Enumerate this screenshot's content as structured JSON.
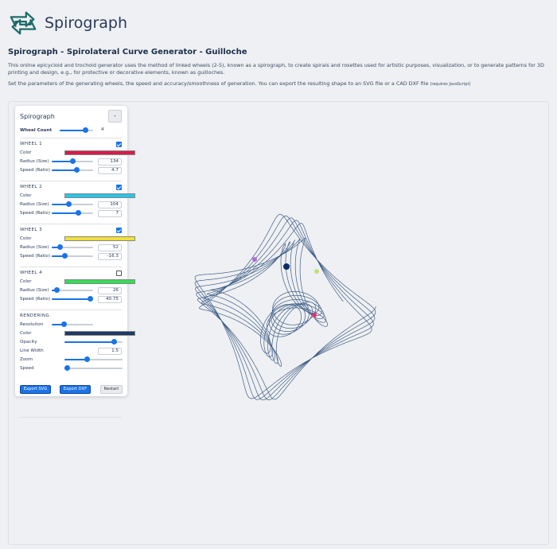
{
  "brand": {
    "name": "Spirograph",
    "logo_icon": "arrows-exchange-icon"
  },
  "page": {
    "title": "Spirograph - Spirolateral Curve Generator - Guilloche",
    "intro": "This online epicycloid and trochoid generator uses the method of linked wheels (2-5), known as a spirograph, to create spirals and rosettes used for artistic purposes, visualization, or to generate patterns for 3D printing and design, e.g., for protective or decorative elements, known as guilloches.",
    "instructions": "Set the parameters of the generating wheels, the speed and accuracy/smoothness of generation. You can export the resulting shape to an SVG file or a CAD DXF file",
    "requires": "(requires JavaScript)"
  },
  "panel": {
    "title": "Spirograph",
    "collapse_label": "-",
    "wheel_count": {
      "label": "Wheel Count",
      "value": "4",
      "level": 0.75
    },
    "wheels": [
      {
        "heading": "WHEEL 1",
        "enabled": true,
        "color_label": "Color",
        "color": "#d81b4a",
        "radius_label": "Radius (Size)",
        "radius": "134",
        "radius_level": 0.5,
        "speed_label": "Speed (Ratio)",
        "speed": "4.7",
        "speed_level": 0.6
      },
      {
        "heading": "WHEEL 2",
        "enabled": true,
        "color_label": "Color",
        "color": "#29c4e8",
        "radius_label": "Radius (Size)",
        "radius": "104",
        "radius_level": 0.4,
        "speed_label": "Speed (Ratio)",
        "speed": "7",
        "speed_level": 0.63
      },
      {
        "heading": "WHEEL 3",
        "enabled": true,
        "color_label": "Color",
        "color": "#f2e034",
        "radius_label": "Radius (Size)",
        "radius": "52",
        "radius_level": 0.2,
        "speed_label": "Speed (Ratio)",
        "speed": "-16.3",
        "speed_level": 0.3
      },
      {
        "heading": "WHEEL 4",
        "enabled": false,
        "color_label": "Color",
        "color": "#33dd55",
        "radius_label": "Radius (Size)",
        "radius": "26",
        "radius_level": 0.12,
        "speed_label": "Speed (Ratio)",
        "speed": "40.75",
        "speed_level": 0.92
      }
    ],
    "rendering": {
      "heading": "RENDERING",
      "resolution_label": "Resolution",
      "resolution_level": 0.28,
      "color_label": "Color",
      "color": "#1c3a66",
      "opacity_label": "Opacity",
      "opacity_level": 0.85,
      "line_width_label": "Line Width",
      "line_width": "1.5",
      "zoom_label": "Zoom",
      "zoom_level": 0.38,
      "speed_label": "Speed",
      "speed_level": 0.04
    },
    "buttons": {
      "export_svg": "Export SVG",
      "export_dxf": "Export DXF",
      "restart": "Restart"
    }
  },
  "canvas": {
    "line_color": "#2d4f7c",
    "wheel_marker_colors": [
      "#0b2d66",
      "#c1e07a",
      "#e0336d",
      "#b06ed4"
    ]
  }
}
